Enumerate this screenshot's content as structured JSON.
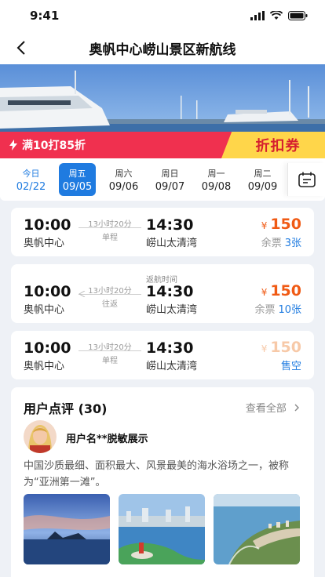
{
  "status": {
    "time": "9:41"
  },
  "nav": {
    "title": "奥帆中心崂山景区新航线"
  },
  "promo": {
    "left_text": "满10打85折",
    "right_text": "折扣券"
  },
  "dates": [
    {
      "weekday": "今日",
      "date": "02/22",
      "state": "today"
    },
    {
      "weekday": "周五",
      "date": "09/05",
      "state": "active"
    },
    {
      "weekday": "周六",
      "date": "09/06",
      "state": ""
    },
    {
      "weekday": "周日",
      "date": "09/07",
      "state": ""
    },
    {
      "weekday": "周一",
      "date": "09/08",
      "state": ""
    },
    {
      "weekday": "周二",
      "date": "09/09",
      "state": ""
    }
  ],
  "trips": [
    {
      "dep_time": "10:00",
      "dep_name": "奥帆中心",
      "duration": "13小时20分",
      "kind": "单程",
      "return_label": "",
      "arr_time": "14:30",
      "arr_name": "崂山太清湾",
      "currency": "¥",
      "price": "150",
      "seats_label": "余票",
      "seats": "3张"
    },
    {
      "dep_time": "10:00",
      "dep_name": "奥帆中心",
      "duration": "13小时20分",
      "kind": "往返",
      "return_label": "返航时间",
      "arr_time": "14:30",
      "arr_name": "崂山太清湾",
      "currency": "¥",
      "price": "150",
      "seats_label": "余票",
      "seats": "10张"
    },
    {
      "dep_time": "10:00",
      "dep_name": "奥帆中心",
      "duration": "13小时20分",
      "kind": "单程",
      "return_label": "",
      "arr_time": "14:30",
      "arr_name": "崂山太清湾",
      "currency": "¥",
      "price": "150",
      "seats_label": "",
      "seats": "售空"
    }
  ],
  "reviews": {
    "title": "用户点评 (30)",
    "view_all": "查看全部",
    "user_name": "用户名**脱敏展示",
    "text": "中国沙质最细、面积最大、风景最美的海水浴场之一，被称为“亚洲第一滩”。"
  },
  "colors": {
    "accent": "#1f7be0",
    "promo_red": "#f0304f",
    "promo_yellow": "#ffd64a",
    "price": "#f05a14"
  }
}
